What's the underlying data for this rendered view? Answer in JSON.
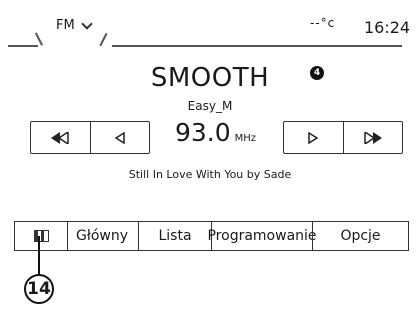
{
  "header": {
    "source_label": "FM",
    "source_dropdown_icon": "chevron-down-icon",
    "temperature": "--°c",
    "clock": "16:24"
  },
  "station": {
    "name": "SMOOTH",
    "badge": "4",
    "subtitle": "Easy_M",
    "frequency": "93.0",
    "unit": "MHz",
    "now_playing": "Still In Love With You by Sade"
  },
  "controls": {
    "seek_back_icon": "seek-back-icon",
    "step_back_icon": "step-back-icon",
    "step_forward_icon": "step-forward-icon",
    "seek_forward_icon": "seek-forward-icon"
  },
  "tabs": {
    "flag_icon": "flag-icon",
    "main": "Główny",
    "list": "Lista",
    "programming": "Programowanie",
    "options": "Opcje"
  },
  "callout": {
    "number": "14"
  }
}
